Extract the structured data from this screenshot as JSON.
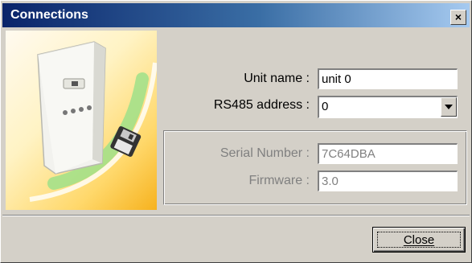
{
  "window": {
    "title": "Connections",
    "close_glyph": "×"
  },
  "form": {
    "unit_name": {
      "label": "Unit name :",
      "value": "unit 0"
    },
    "rs485_address": {
      "label": "RS485 address :",
      "value": "0"
    }
  },
  "info": {
    "serial_number": {
      "label": "Serial Number :",
      "value": "7C64DBA"
    },
    "firmware": {
      "label": "Firmware :",
      "value": "3.0"
    }
  },
  "buttons": {
    "close": {
      "label": "Close"
    }
  },
  "icons": {
    "art": "device-with-floppy-illustration",
    "dropdown": "chevron-down-icon"
  }
}
